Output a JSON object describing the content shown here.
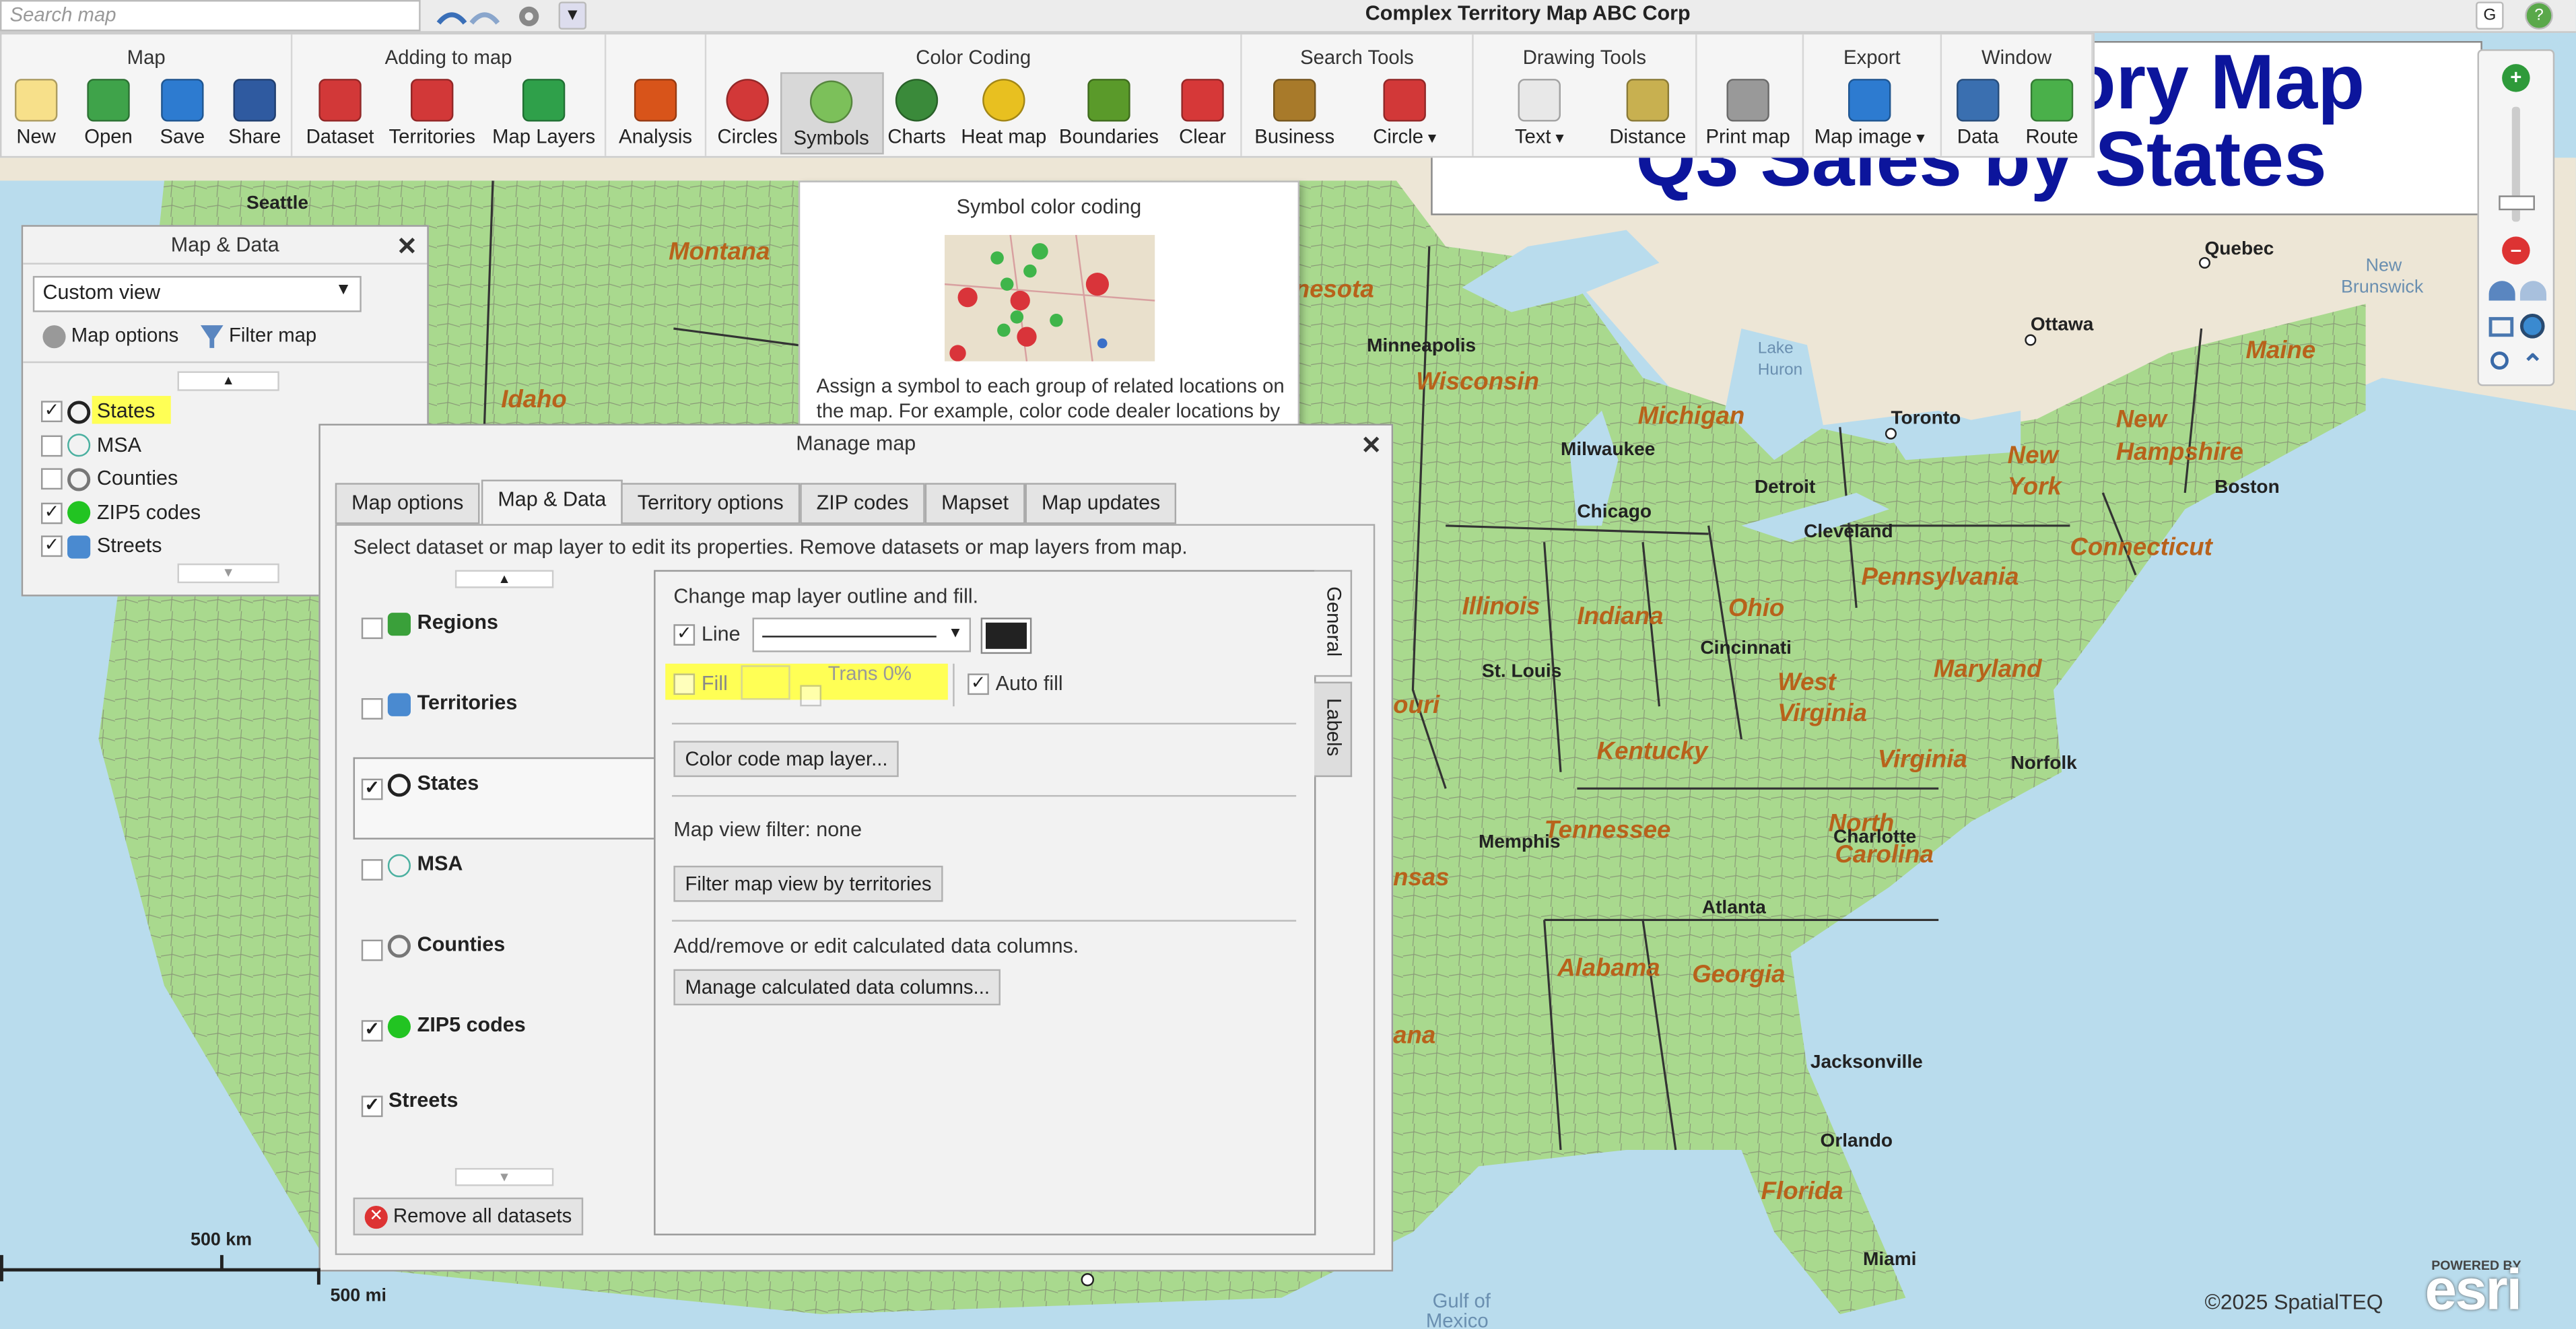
{
  "app": {
    "title": "Complex Territory Map ABC Corp",
    "search_placeholder": "Search map",
    "quick_g": "G",
    "quick_help": "?"
  },
  "ribbon": {
    "groups": [
      {
        "title": "Map",
        "items": [
          "New",
          "Open",
          "Save",
          "Share"
        ]
      },
      {
        "title": "Adding to map",
        "items": [
          "Dataset",
          "Territories",
          "Map Layers"
        ]
      },
      {
        "title": "",
        "items": [
          "Analysis"
        ]
      },
      {
        "title": "Color Coding",
        "items": [
          "Circles",
          "Symbols",
          "Charts",
          "Heat map",
          "Boundaries",
          "Clear"
        ]
      },
      {
        "title": "Search Tools",
        "items": [
          "Business",
          "Circle"
        ]
      },
      {
        "title": "Drawing Tools",
        "items": [
          "Text",
          "Distance"
        ]
      },
      {
        "title": "",
        "items": [
          "Print map"
        ]
      },
      {
        "title": "Export",
        "items": [
          "Map image"
        ]
      },
      {
        "title": "Window",
        "items": [
          "Data",
          "Route"
        ]
      }
    ]
  },
  "map_title": {
    "line1": "Territory Map",
    "line2": "Q3 Sales by States"
  },
  "tooltip": {
    "title": "Symbol color coding",
    "text": "Assign a symbol to each group of related locations on the map. For example, color code dealer locations by type."
  },
  "map_data_panel": {
    "title": "Map & Data",
    "view": "Custom view",
    "map_options": "Map options",
    "filter_map": "Filter map",
    "layers": [
      {
        "name": "States",
        "checked": true
      },
      {
        "name": "MSA",
        "checked": false
      },
      {
        "name": "Counties",
        "checked": false
      },
      {
        "name": "ZIP5 codes",
        "checked": true
      },
      {
        "name": "Streets",
        "checked": true
      }
    ]
  },
  "manage_dialog": {
    "title": "Manage map",
    "tabs": [
      "Map options",
      "Map & Data",
      "Territory options",
      "ZIP codes",
      "Mapset",
      "Map updates"
    ],
    "instruction": "Select dataset or map layer to edit its properties. Remove datasets or map layers from map.",
    "layers": [
      {
        "name": "Regions",
        "checked": false
      },
      {
        "name": "Territories",
        "checked": false
      },
      {
        "name": "States",
        "checked": true
      },
      {
        "name": "MSA",
        "checked": false
      },
      {
        "name": "Counties",
        "checked": false
      },
      {
        "name": "ZIP5 codes",
        "checked": true
      },
      {
        "name": "Streets",
        "checked": true
      }
    ],
    "remove_all": "Remove all datasets",
    "general": {
      "heading": "Change map layer outline and fill.",
      "line_label": "Line",
      "fill_label": "Fill",
      "trans": "Trans 0%",
      "auto_fill": "Auto fill",
      "color_code": "Color code map layer...",
      "filter_status": "Map view filter: none",
      "filter_btn": "Filter map view by territories",
      "calc_text": "Add/remove or edit calculated data columns.",
      "calc_btn": "Manage calculated data columns..."
    },
    "side_tabs": [
      "General",
      "Labels"
    ]
  },
  "map_labels": {
    "states": [
      "Montana",
      "Idaho",
      "Wisconsin",
      "Michigan",
      "New York",
      "New Hampshire",
      "Maine",
      "Connecticut",
      "Pennsylvania",
      "Ohio",
      "Indiana",
      "Illinois",
      "West Virginia",
      "Maryland",
      "Virginia",
      "Kentucky",
      "Tennessee",
      "North Carolina",
      "Alabama",
      "Georgia",
      "Florida",
      "nesota",
      "ouri",
      "nsas",
      "ana"
    ],
    "cities": [
      "Seattle",
      "Quebec",
      "Ottawa",
      "Toronto",
      "Milwaukee",
      "Chicago",
      "Detroit",
      "Cleveland",
      "Boston",
      "Norfolk",
      "Jacksonville",
      "Miami",
      "Orlando",
      "Memphis",
      "St. Louis",
      "Cincinnati",
      "Atlanta",
      "Charlotte",
      "Minneapolis"
    ],
    "water": [
      "New Brunswick",
      "Lake Huron",
      "Gulf of Mexico"
    ]
  },
  "scale": {
    "km": "500 km",
    "mi": "500 mi"
  },
  "copyright": "©2025 SpatialTEQ",
  "esri": {
    "powered": "POWERED BY",
    "logo": "esri"
  }
}
